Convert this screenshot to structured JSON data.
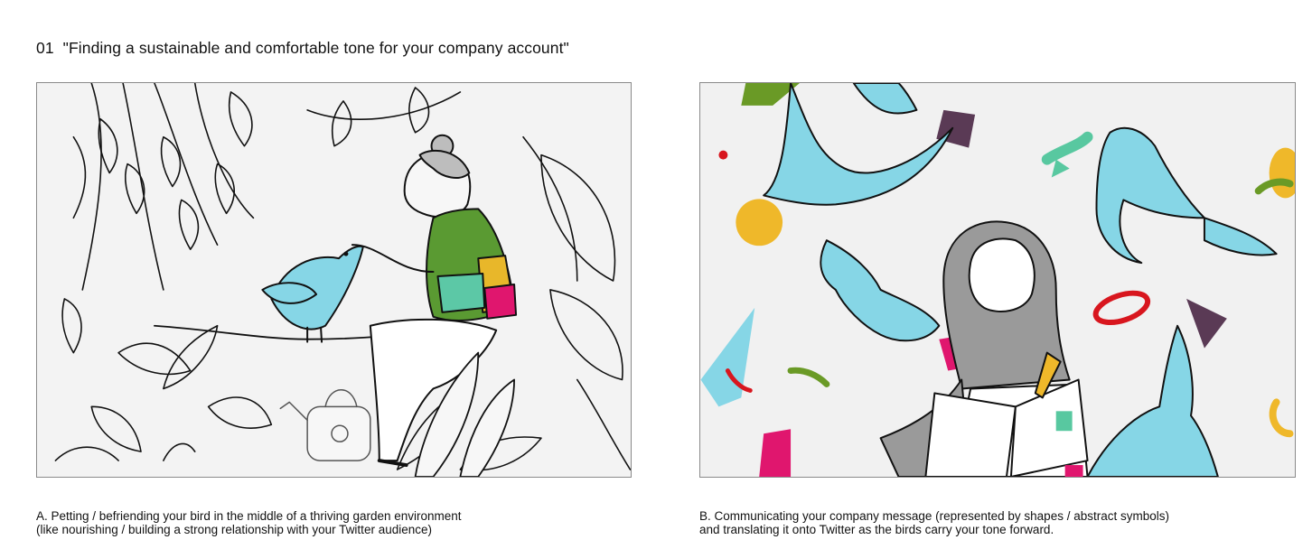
{
  "heading": {
    "number": "01",
    "title": "\"Finding a sustainable and comfortable tone for your company account\""
  },
  "illustrations": [
    {
      "id": "A",
      "subject": "garden-scene",
      "colors": {
        "bird": "#86d6e6",
        "accent_green": "#5a9a32",
        "accent_yellow": "#e8b72a",
        "accent_pink": "#e0166e",
        "accent_mint": "#5cc8a6"
      }
    },
    {
      "id": "B",
      "subject": "birds-and-shapes-scene",
      "colors": {
        "bird": "#86d6e6",
        "purple": "#5a3a55",
        "yellow": "#efb82a",
        "red": "#d8161e",
        "pink": "#e0166e",
        "green": "#6a9a26",
        "mint": "#58c8a0"
      }
    }
  ],
  "captions": {
    "a": {
      "line1": "A. Petting / befriending your bird in the middle of a thriving garden environment",
      "line2": "(like nourishing / building a strong relationship with your Twitter audience)"
    },
    "b": {
      "line1": "B. Communicating your company message (represented by shapes / abstract symbols)",
      "line2": "and translating it onto Twitter as the birds carry your tone forward."
    }
  }
}
